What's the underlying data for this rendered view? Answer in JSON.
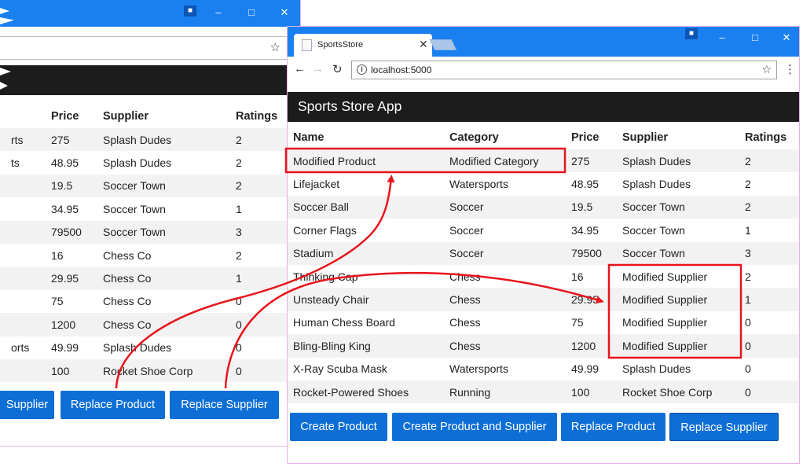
{
  "back_window": {
    "star_icon": "star-outline-icon",
    "table": {
      "headers": [
        "",
        "Price",
        "Supplier",
        "Ratings"
      ],
      "rows": [
        [
          "rts",
          "275",
          "Splash Dudes",
          "2"
        ],
        [
          "ts",
          "48.95",
          "Splash Dudes",
          "2"
        ],
        [
          "",
          "19.5",
          "Soccer Town",
          "2"
        ],
        [
          "",
          "34.95",
          "Soccer Town",
          "1"
        ],
        [
          "",
          "79500",
          "Soccer Town",
          "3"
        ],
        [
          "",
          "16",
          "Chess Co",
          "2"
        ],
        [
          "",
          "29.95",
          "Chess Co",
          "1"
        ],
        [
          "",
          "75",
          "Chess Co",
          "0"
        ],
        [
          "",
          "1200",
          "Chess Co",
          "0"
        ],
        [
          "orts",
          "49.99",
          "Splash Dudes",
          "0"
        ],
        [
          "",
          "100",
          "Rocket Shoe Corp",
          "0"
        ]
      ]
    },
    "buttons": [
      "Supplier",
      "Replace Product",
      "Replace Supplier"
    ]
  },
  "front_window": {
    "tab_title": "SportsStore",
    "url": "localhost:5000",
    "app_title": "Sports Store App",
    "table": {
      "headers": [
        "Name",
        "Category",
        "Price",
        "Supplier",
        "Ratings"
      ],
      "rows": [
        [
          "Modified Product",
          "Modified Category",
          "275",
          "Splash Dudes",
          "2"
        ],
        [
          "Lifejacket",
          "Watersports",
          "48.95",
          "Splash Dudes",
          "2"
        ],
        [
          "Soccer Ball",
          "Soccer",
          "19.5",
          "Soccer Town",
          "2"
        ],
        [
          "Corner Flags",
          "Soccer",
          "34.95",
          "Soccer Town",
          "1"
        ],
        [
          "Stadium",
          "Soccer",
          "79500",
          "Soccer Town",
          "3"
        ],
        [
          "Thinking Cap",
          "Chess",
          "16",
          "Modified Supplier",
          "2"
        ],
        [
          "Unsteady Chair",
          "Chess",
          "29.95",
          "Modified Supplier",
          "1"
        ],
        [
          "Human Chess Board",
          "Chess",
          "75",
          "Modified Supplier",
          "0"
        ],
        [
          "Bling-Bling King",
          "Chess",
          "1200",
          "Modified Supplier",
          "0"
        ],
        [
          "X-Ray Scuba Mask",
          "Watersports",
          "49.99",
          "Splash Dudes",
          "0"
        ],
        [
          "Rocket-Powered Shoes",
          "Running",
          "100",
          "Rocket Shoe Corp",
          "0"
        ]
      ]
    },
    "buttons": [
      "Create Product",
      "Create Product and Supplier",
      "Replace Product",
      "Replace Supplier"
    ]
  },
  "colors": {
    "titlebar": "#1a80f0",
    "app_header": "#1c1c1c",
    "button": "#0d6fd6",
    "highlight": "#e8141b"
  },
  "icons": {
    "minimize": "minimize-icon",
    "maximize": "maximize-icon",
    "close": "close-icon",
    "back": "back-arrow-icon",
    "forward": "forward-arrow-icon",
    "reload": "reload-icon",
    "info": "info-icon",
    "menu": "kebab-menu-icon"
  }
}
